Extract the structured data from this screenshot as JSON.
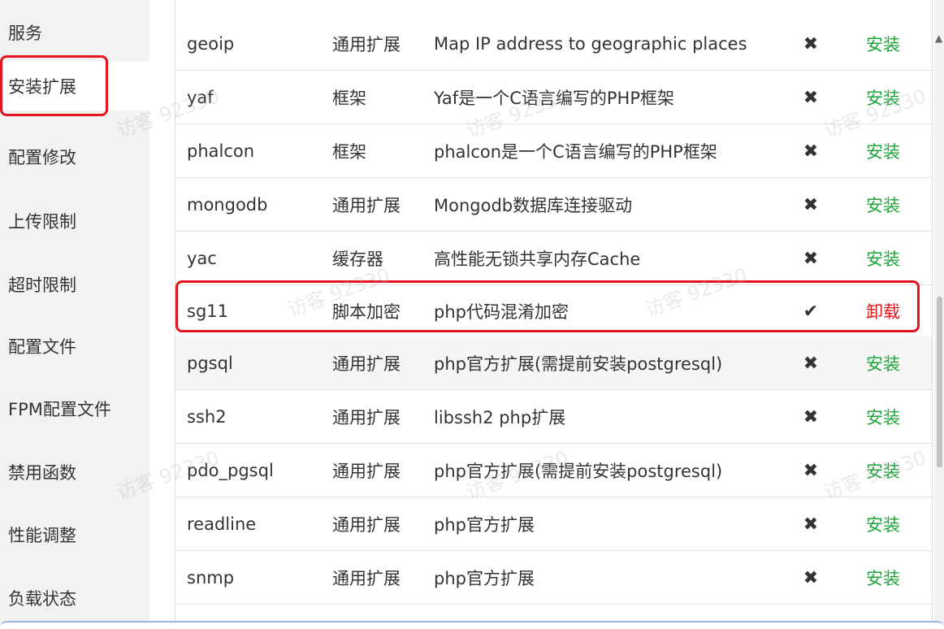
{
  "sidebar": {
    "items": [
      {
        "label": "服务"
      },
      {
        "label": "安装扩展"
      },
      {
        "label": "配置修改"
      },
      {
        "label": "上传限制"
      },
      {
        "label": "超时限制"
      },
      {
        "label": "配置文件"
      },
      {
        "label": "FPM配置文件"
      },
      {
        "label": "禁用函数"
      },
      {
        "label": "性能调整"
      },
      {
        "label": "负载状态"
      }
    ],
    "active_item": "安装扩展"
  },
  "extensions": [
    {
      "name": "geoip",
      "type": "通用扩展",
      "desc": "Map IP address to geographic places",
      "status": "✖",
      "action": "安装"
    },
    {
      "name": "yaf",
      "type": "框架",
      "desc": "Yaf是一个C语言编写的PHP框架",
      "status": "✖",
      "action": "安装"
    },
    {
      "name": "phalcon",
      "type": "框架",
      "desc": "phalcon是一个C语言编写的PHP框架",
      "status": "✖",
      "action": "安装"
    },
    {
      "name": "mongodb",
      "type": "通用扩展",
      "desc": "Mongodb数据库连接驱动",
      "status": "✖",
      "action": "安装"
    },
    {
      "name": "yac",
      "type": "缓存器",
      "desc": "高性能无锁共享内存Cache",
      "status": "✖",
      "action": "安装"
    },
    {
      "name": "sg11",
      "type": "脚本加密",
      "desc": "php代码混淆加密",
      "status": "✔",
      "action": "卸载"
    },
    {
      "name": "pgsql",
      "type": "通用扩展",
      "desc": "php官方扩展(需提前安装postgresql)",
      "status": "✖",
      "action": "安装"
    },
    {
      "name": "ssh2",
      "type": "通用扩展",
      "desc": "libssh2 php扩展",
      "status": "✖",
      "action": "安装"
    },
    {
      "name": "pdo_pgsql",
      "type": "通用扩展",
      "desc": "php官方扩展(需提前安装postgresql)",
      "status": "✖",
      "action": "安装"
    },
    {
      "name": "readline",
      "type": "通用扩展",
      "desc": "php官方扩展",
      "status": "✖",
      "action": "安装"
    },
    {
      "name": "snmp",
      "type": "通用扩展",
      "desc": "php官方扩展",
      "status": "✖",
      "action": "安装"
    }
  ],
  "watermark": "访客 92330",
  "colors": {
    "install": "#20a53a",
    "uninstall": "#e3141b",
    "highlight_border": "#e3141b",
    "sidebar_bg": "#f2f2f2"
  }
}
